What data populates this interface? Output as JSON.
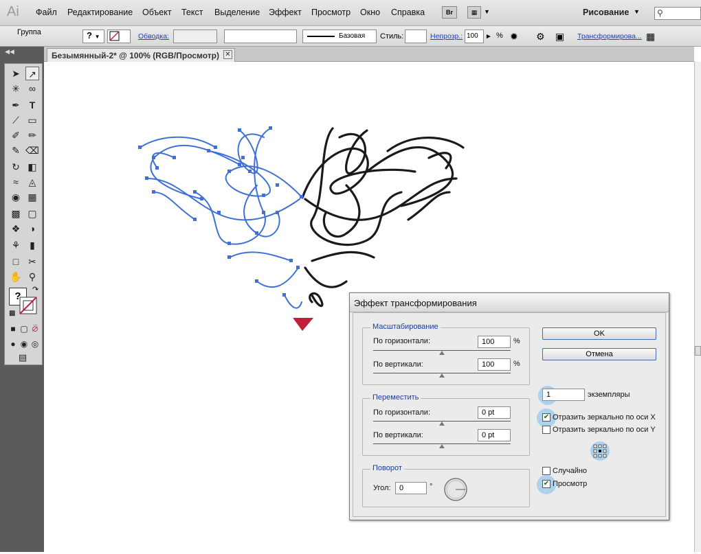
{
  "app": {
    "logo": "Ai"
  },
  "menu": [
    "Файл",
    "Редактирование",
    "Объект",
    "Текст",
    "Выделение",
    "Эффект",
    "Просмотр",
    "Окно",
    "Справка"
  ],
  "menubar_right": {
    "bridge": "Br",
    "workspace": "Рисование",
    "search_placeholder": ""
  },
  "controlbar": {
    "selection": "Группа",
    "fill_value": "?",
    "stroke_link": "Обводка:",
    "stroke_style": "Базовая",
    "style_label": "Стиль:",
    "opacity_link": "Непрозр.:",
    "opacity_value": "100",
    "percent": "%",
    "transform_link": "Трансформирова..."
  },
  "document": {
    "tab_title": "Безымянный-2* @ 100% (RGB/Просмотр)"
  },
  "tools": {
    "fill_indicator": "?"
  },
  "dialog": {
    "title": "Эффект трансформирования",
    "scale": {
      "title": "Масштабирование",
      "horizontal_label": "По горизонтали:",
      "horizontal_value": "100",
      "vertical_label": "По вертикали:",
      "vertical_value": "100",
      "unit": "%"
    },
    "move": {
      "title": "Переместить",
      "horizontal_label": "По горизонтали:",
      "horizontal_value": "0 pt",
      "vertical_label": "По вертикали:",
      "vertical_value": "0 pt"
    },
    "rotate": {
      "title": "Поворот",
      "angle_label": "Угол:",
      "angle_value": "0",
      "degree": "°"
    },
    "ok": "OK",
    "cancel": "Отмена",
    "copies_value": "1",
    "copies_label": "экземпляры",
    "reflect_x_label": "Отразить зеркально по оси X",
    "reflect_x": true,
    "reflect_y_label": "Отразить зеркально по оси Y",
    "reflect_y": false,
    "random_label": "Случайно",
    "random": false,
    "preview_label": "Просмотр",
    "preview": true
  },
  "colors": {
    "selection_blue": "#3f6fd8",
    "accent_red": "#c0203c"
  }
}
